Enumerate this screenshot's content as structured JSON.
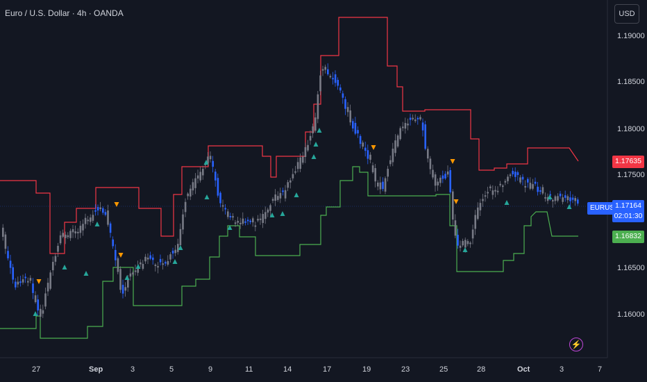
{
  "header": {
    "title": "Euro / U.S. Dollar · 4h · OANDA",
    "currency_button": "USD"
  },
  "price_axis": {
    "ticks": [
      "1.19000",
      "1.18500",
      "1.18000",
      "1.17500",
      "1.16500",
      "1.16000"
    ]
  },
  "time_axis": {
    "ticks": [
      "27",
      "Sep",
      "3",
      "5",
      "9",
      "11",
      "14",
      "17",
      "19",
      "23",
      "25",
      "28",
      "Oct",
      "3",
      "7"
    ]
  },
  "tags": {
    "upper_band": "1.17635",
    "lower_band": "1.16832",
    "symbol": "EURUSD",
    "last_price": "1.17164",
    "countdown": "02:01:30"
  },
  "colors": {
    "background": "#131722",
    "upper_band": "#f23645",
    "lower_band": "#4caf50",
    "bull_candle": "#787b86",
    "bear_candle": "#2962ff",
    "buy_signal": "#26a69a",
    "sell_signal": "#ff9800",
    "last_price": "#2962ff"
  },
  "icons": {
    "bottom_right": "lightning-icon"
  }
}
